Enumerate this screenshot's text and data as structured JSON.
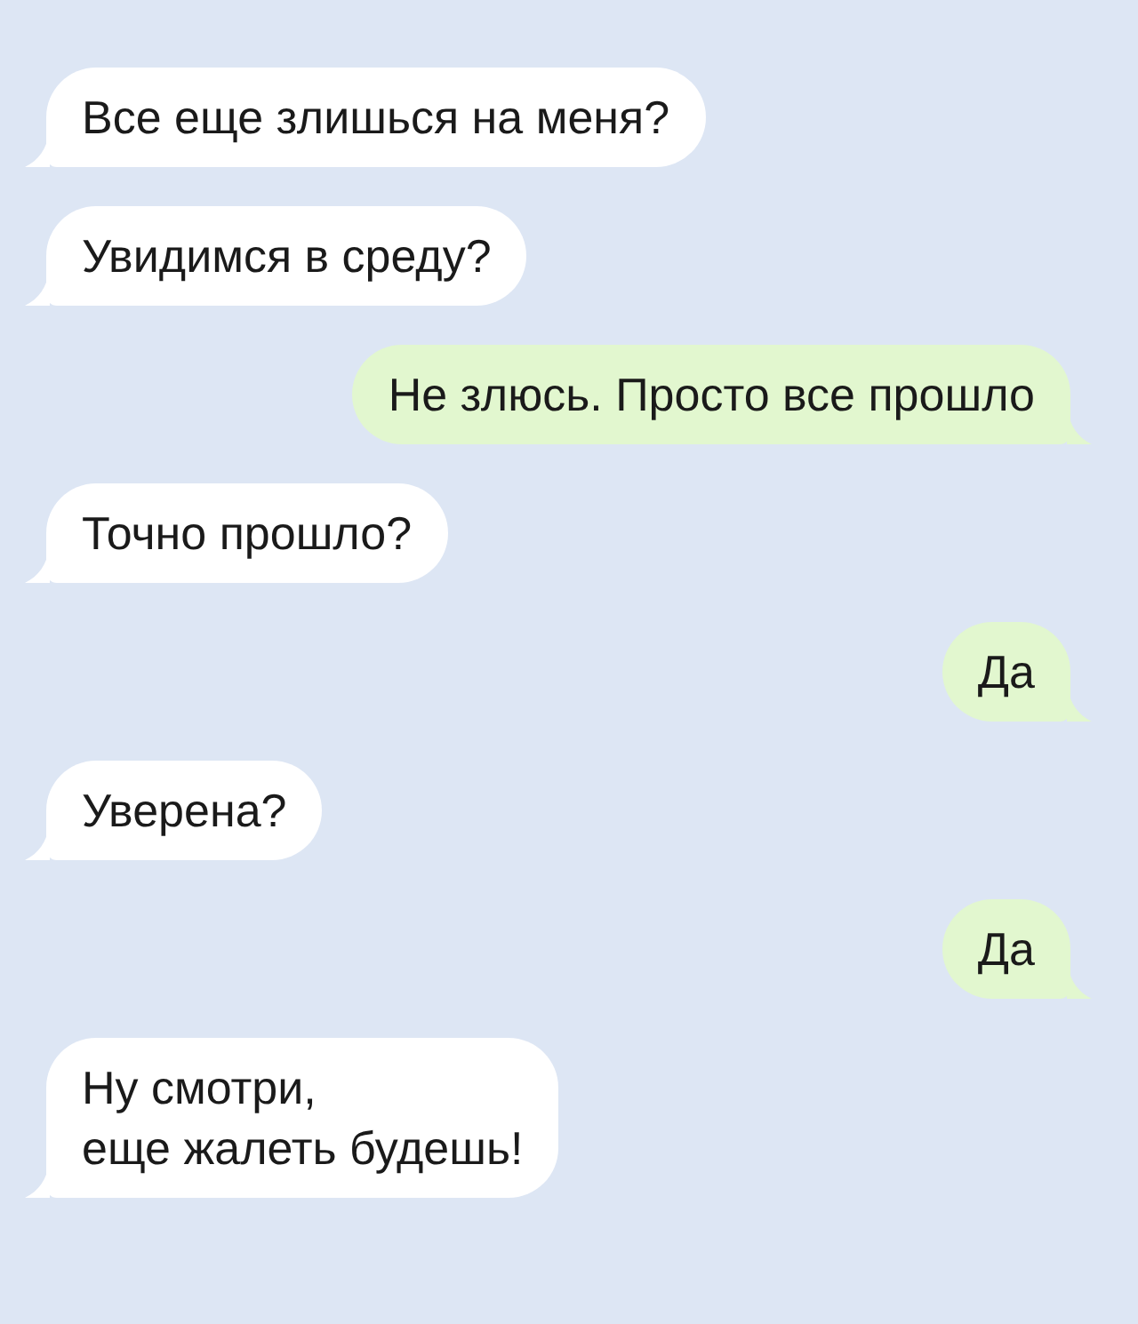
{
  "messages": [
    {
      "text": "Все еще злишься на меня?",
      "outgoing": false
    },
    {
      "text": "Увидимся в среду?",
      "outgoing": false
    },
    {
      "text": "Не злюсь. Просто все прошло",
      "outgoing": true
    },
    {
      "text": "Точно прошло?",
      "outgoing": false
    },
    {
      "text": "Да",
      "outgoing": true
    },
    {
      "text": "Уверена?",
      "outgoing": false
    },
    {
      "text": "Да",
      "outgoing": true
    },
    {
      "text": "Ну смотри,\nеще жалеть будешь!",
      "outgoing": false
    }
  ]
}
